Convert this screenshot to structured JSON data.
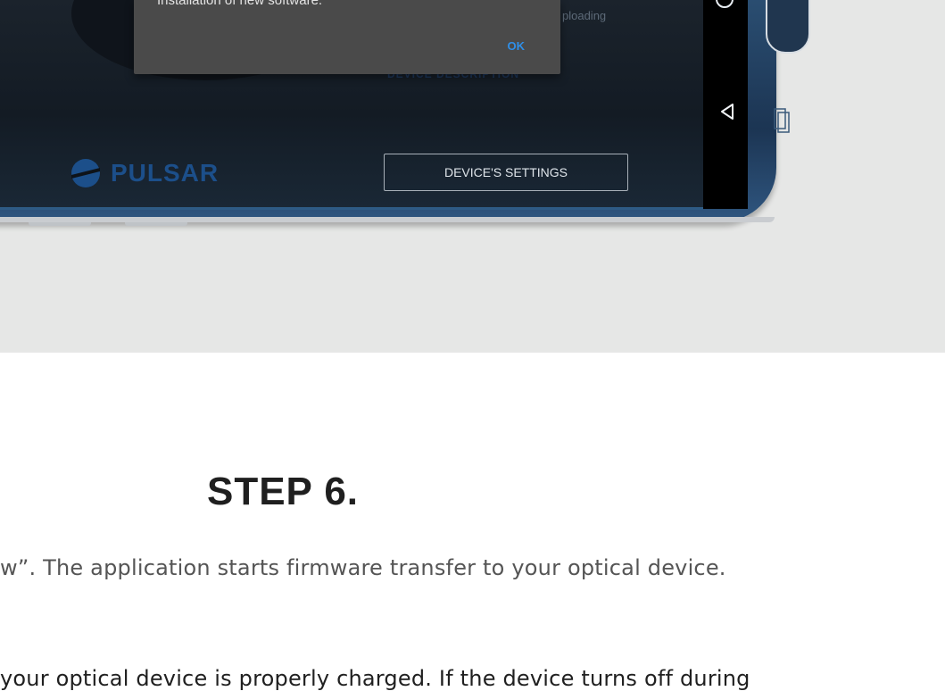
{
  "screen": {
    "dialog_message": "Installation of new software.",
    "dialog_ok": "OK",
    "status_text": "ploading",
    "ghost_link": "DEVICE DESCRIPTION",
    "brand": "PULSAR",
    "settings_button": "DEVICE'S SETTINGS"
  },
  "article": {
    "step_title": "STEP 6.",
    "paragraph_1": "w”. The application starts firmware transfer to your optical device.",
    "paragraph_2": " your optical device is properly charged. If the device turns off during"
  },
  "icons": [
    "home-circle-icon",
    "back-triangle-icon",
    "recent-apps-icon",
    "pulsar-logo-icon"
  ],
  "colors": {
    "dialog_bg": "#4a4a4a",
    "ok_blue": "#2f8fe8",
    "brand_blue": "#1c4f8a",
    "hero_bg": "#e6e7e6"
  }
}
